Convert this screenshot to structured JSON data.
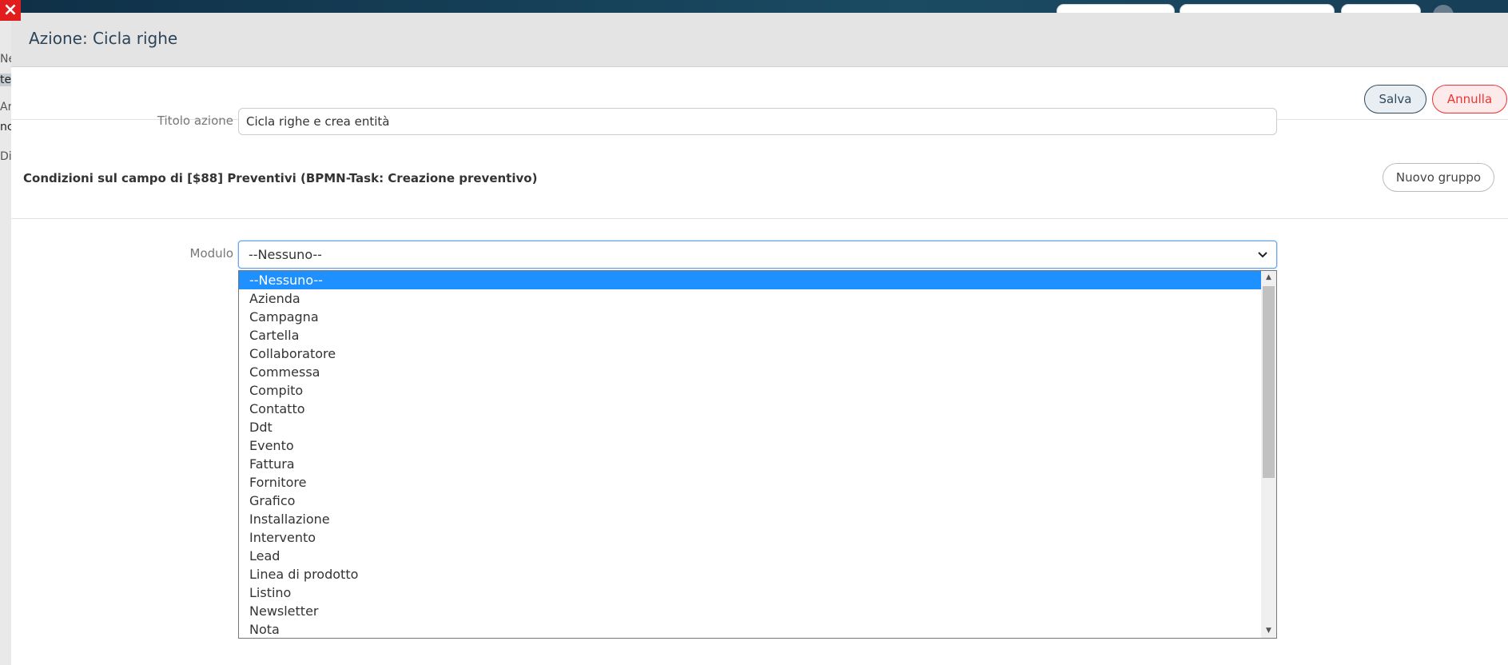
{
  "background": {
    "left_fragments": [
      "Ne",
      "te",
      "Ar",
      "nc",
      "Di"
    ]
  },
  "close_icon": "×",
  "modal": {
    "title": "Azione: Cicla righe",
    "save_label": "Salva",
    "cancel_label": "Annulla",
    "title_field": {
      "label": "Titolo azione",
      "value": "Cicla righe e crea entità"
    },
    "conditions_text": "Condizioni sul campo di [$88] Preventivi (BPMN-Task: Creazione preventivo)",
    "new_group_label": "Nuovo gruppo",
    "module_field": {
      "label": "Modulo",
      "selected_value": "--Nessuno--",
      "options": [
        "--Nessuno--",
        "Azienda",
        "Campagna",
        "Cartella",
        "Collaboratore",
        "Commessa",
        "Compito",
        "Contatto",
        "Ddt",
        "Evento",
        "Fattura",
        "Fornitore",
        "Grafico",
        "Installazione",
        "Intervento",
        "Lead",
        "Linea di prodotto",
        "Listino",
        "Newsletter",
        "Nota"
      ],
      "highlighted_index": 0
    }
  },
  "colors": {
    "save_border": "#2d4a61",
    "cancel": "#e33333",
    "selected_option": "#1e90ff",
    "close_button": "#e21d1d"
  }
}
